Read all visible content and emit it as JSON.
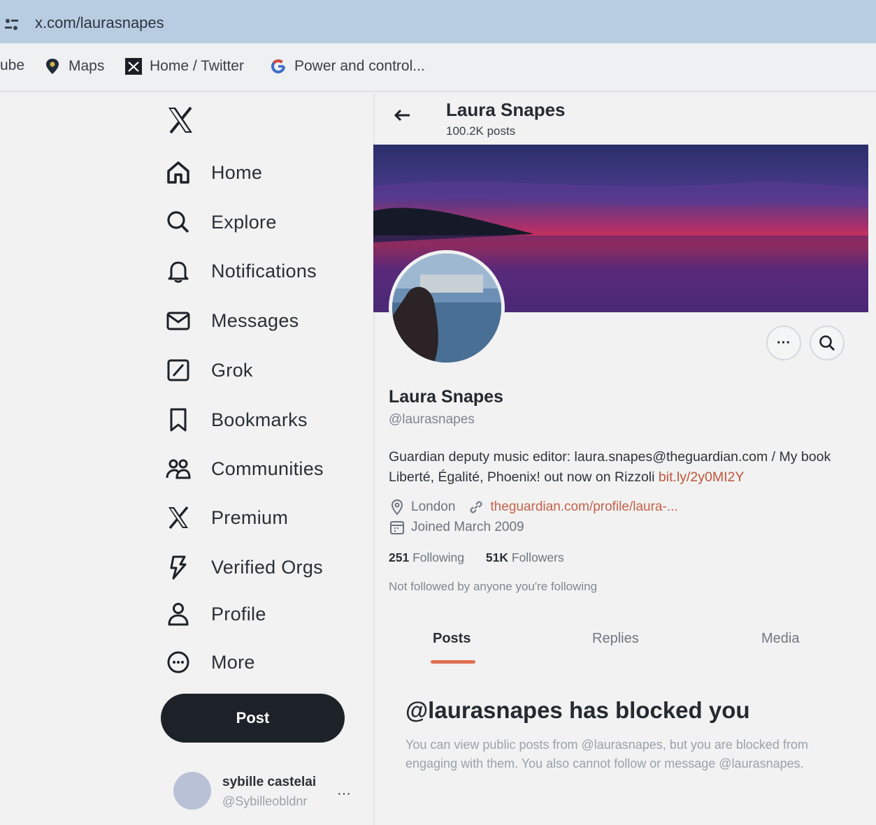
{
  "browser": {
    "url": "x.com/laurasnapes",
    "bookmarks": [
      {
        "label": "ube",
        "icon": "youtube-icon"
      },
      {
        "label": "Maps",
        "icon": "maps-pin-icon"
      },
      {
        "label": "Home / Twitter",
        "icon": "twitter-favicon-icon"
      },
      {
        "label": "Power and control...",
        "icon": "google-icon"
      }
    ]
  },
  "sidebar": {
    "logo": "x-logo-icon",
    "items": [
      {
        "label": "Home",
        "icon": "home-icon"
      },
      {
        "label": "Explore",
        "icon": "search-icon"
      },
      {
        "label": "Notifications",
        "icon": "bell-icon"
      },
      {
        "label": "Messages",
        "icon": "envelope-icon"
      },
      {
        "label": "Grok",
        "icon": "grok-icon"
      },
      {
        "label": "Bookmarks",
        "icon": "bookmark-icon"
      },
      {
        "label": "Communities",
        "icon": "communities-icon"
      },
      {
        "label": "Premium",
        "icon": "x-premium-icon"
      },
      {
        "label": "Verified Orgs",
        "icon": "lightning-icon"
      },
      {
        "label": "Profile",
        "icon": "person-icon"
      },
      {
        "label": "More",
        "icon": "more-circle-icon"
      }
    ],
    "post_label": "Post",
    "account": {
      "name": "sybille castelai",
      "handle": "@Sybilleobldnr",
      "more": "···"
    }
  },
  "header": {
    "title": "Laura Snapes",
    "posts_count": "100.2K posts"
  },
  "profile": {
    "name": "Laura Snapes",
    "handle": "@laurasnapes",
    "bio_text": "Guardian deputy music editor: laura.snapes@theguardian.com / My book Liberté, Égalité, Phoenix! out now on Rizzoli ",
    "bio_link": "bit.ly/2y0MI2Y",
    "location": "London",
    "website": "theguardian.com/profile/laura-...",
    "joined": "Joined March 2009",
    "following_count": "251",
    "following_label": "Following",
    "followers_count": "51K",
    "followers_label": "Followers",
    "not_followed": "Not followed by anyone you're following",
    "more_button": "···"
  },
  "tabs": [
    {
      "label": "Posts",
      "active": true
    },
    {
      "label": "Replies",
      "active": false
    },
    {
      "label": "Media",
      "active": false
    }
  ],
  "blocked": {
    "title": "@laurasnapes has blocked you",
    "message": "You can view public posts from @laurasnapes, but you are blocked from engaging with them. You also cannot follow or message @laurasnapes."
  },
  "colors": {
    "accent": "#e07050",
    "link": "#c0533b",
    "post_button": "#1d2228"
  }
}
